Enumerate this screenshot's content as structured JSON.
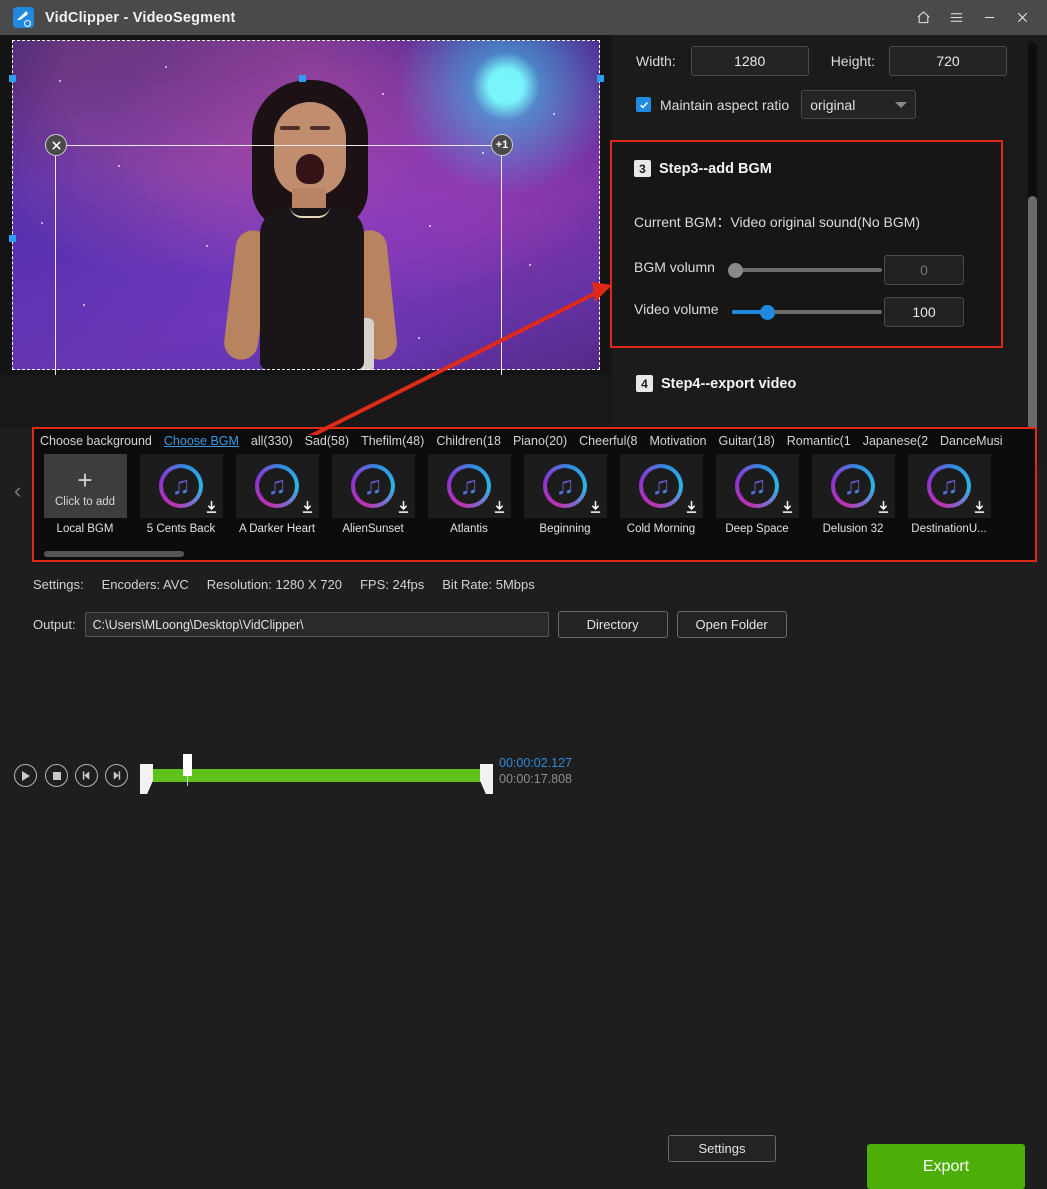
{
  "window": {
    "title": "VidClipper  - VideoSegment",
    "logo_icon": "scissors-film-icon",
    "controls": [
      {
        "name": "home-icon",
        "label": "⌂"
      },
      {
        "name": "menu-icon",
        "label": "≡"
      },
      {
        "name": "minimize-icon",
        "label": "–"
      },
      {
        "name": "close-icon",
        "label": "✕"
      }
    ]
  },
  "preview": {
    "handles": {
      "delete": "✕",
      "add_layer": "+1",
      "mirror": "mirror-icon",
      "resize": "resize-icon"
    }
  },
  "timeline": {
    "buttons": [
      {
        "name": "play-button",
        "icon": "play-icon"
      },
      {
        "name": "stop-button",
        "icon": "stop-icon"
      },
      {
        "name": "prev-frame-button",
        "icon": "step-back-icon"
      },
      {
        "name": "next-frame-button",
        "icon": "step-forward-icon"
      }
    ],
    "current_time": "00:00:02.127",
    "total_time": "00:00:17.808"
  },
  "settings_panel": {
    "width_label": "Width:",
    "width_value": "1280",
    "height_label": "Height:",
    "height_value": "720",
    "maintain_aspect_label": "Maintain aspect ratio",
    "aspect_value": "original",
    "aspect_checked": true
  },
  "step3": {
    "badge": "3",
    "title": "Step3--add BGM",
    "current_bgm_label": "Current BGM：",
    "current_bgm_value": "Video original sound(No BGM)",
    "bgm_volume_label": "BGM volumn",
    "bgm_volume_value": "0",
    "video_volume_label": "Video volume",
    "video_volume_value": "100"
  },
  "step4": {
    "badge": "4",
    "title": "Step4--export video"
  },
  "library": {
    "tabs": [
      {
        "label": "Choose background",
        "active": false
      },
      {
        "label": "Choose BGM",
        "active": true
      },
      {
        "label": "all(330)",
        "active": false
      },
      {
        "label": "Sad(58)",
        "active": false
      },
      {
        "label": "Thefilm(48)",
        "active": false
      },
      {
        "label": "Children(18",
        "active": false
      },
      {
        "label": "Piano(20)",
        "active": false
      },
      {
        "label": "Cheerful(8",
        "active": false
      },
      {
        "label": "Motivation",
        "active": false
      },
      {
        "label": "Guitar(18)",
        "active": false
      },
      {
        "label": "Romantic(1",
        "active": false
      },
      {
        "label": "Japanese(2",
        "active": false
      },
      {
        "label": "DanceMusi",
        "active": false
      }
    ],
    "items": [
      {
        "name": "Local BGM",
        "type": "add",
        "add_label": "Click to add"
      },
      {
        "name": "5 Cents Back",
        "type": "track"
      },
      {
        "name": "A Darker Heart",
        "type": "track"
      },
      {
        "name": "AlienSunset",
        "type": "track"
      },
      {
        "name": "Atlantis",
        "type": "track"
      },
      {
        "name": "Beginning",
        "type": "track"
      },
      {
        "name": "Cold Morning",
        "type": "track"
      },
      {
        "name": "Deep Space",
        "type": "track"
      },
      {
        "name": "Delusion 32",
        "type": "track"
      },
      {
        "name": "DestinationU...",
        "type": "track"
      }
    ],
    "prev_arrow": "‹",
    "next_arrow": "›"
  },
  "bottom": {
    "settings_label": "Settings:",
    "encoders": "Encoders: AVC",
    "resolution": "Resolution: 1280 X 720",
    "fps": "FPS: 24fps",
    "bitrate": "Bit Rate: 5Mbps",
    "settings_button": "Settings",
    "output_label": "Output:",
    "output_path": "C:\\Users\\MLoong\\Desktop\\VidClipper\\",
    "directory_button": "Directory",
    "open_folder_button": "Open Folder",
    "export_button": "Export"
  },
  "colors": {
    "accent_blue": "#1f8ae0",
    "highlight_red": "#e02a18",
    "export_green": "#4caf08",
    "track_green": "#5ec21b"
  }
}
